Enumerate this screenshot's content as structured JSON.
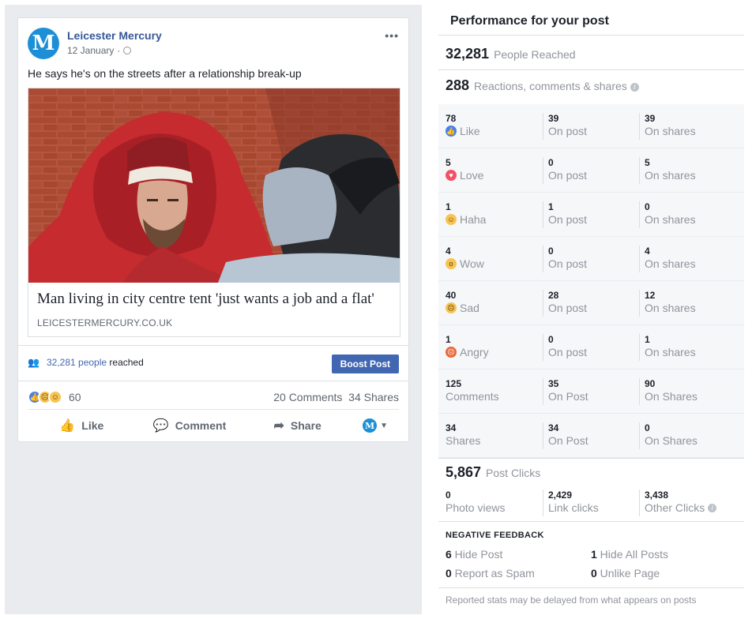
{
  "post": {
    "page_name": "Leicester Mercury",
    "avatar_letter": "M",
    "date": "12 January",
    "meta_sep": "·",
    "more": "•••",
    "text": "He says he's on the streets after a relationship break-up",
    "link_title": "Man living in city centre tent 'just wants a job and a flat'",
    "link_domain": "LEICESTERMERCURY.CO.UK",
    "reach_number": "32,281 people",
    "reach_suffix": " reached",
    "boost_label": "Boost Post",
    "reaction_count": "60",
    "comments": "20 Comments",
    "shares": "34 Shares",
    "actions": {
      "like": "Like",
      "comment": "Comment",
      "share": "Share"
    }
  },
  "performance": {
    "title": "Performance for your post",
    "reached_num": "32,281",
    "reached_label": "People Reached",
    "engagement_num": "288",
    "engagement_label": "Reactions, comments & shares",
    "rows": [
      {
        "icon": "like-icon",
        "c1": "78",
        "l1": "Like",
        "c2": "39",
        "l2": "On post",
        "c3": "39",
        "l3": "On shares"
      },
      {
        "icon": "love-icon",
        "c1": "5",
        "l1": "Love",
        "c2": "0",
        "l2": "On post",
        "c3": "5",
        "l3": "On shares"
      },
      {
        "icon": "haha-icon",
        "c1": "1",
        "l1": "Haha",
        "c2": "1",
        "l2": "On post",
        "c3": "0",
        "l3": "On shares"
      },
      {
        "icon": "wow-icon",
        "c1": "4",
        "l1": "Wow",
        "c2": "0",
        "l2": "On post",
        "c3": "4",
        "l3": "On shares"
      },
      {
        "icon": "sad-icon",
        "c1": "40",
        "l1": "Sad",
        "c2": "28",
        "l2": "On post",
        "c3": "12",
        "l3": "On shares"
      },
      {
        "icon": "angry-icon",
        "c1": "1",
        "l1": "Angry",
        "c2": "0",
        "l2": "On post",
        "c3": "1",
        "l3": "On shares"
      },
      {
        "icon": "",
        "c1": "125",
        "l1": "Comments",
        "c2": "35",
        "l2": "On Post",
        "c3": "90",
        "l3": "On Shares"
      },
      {
        "icon": "",
        "c1": "34",
        "l1": "Shares",
        "c2": "34",
        "l2": "On Post",
        "c3": "0",
        "l3": "On Shares"
      }
    ],
    "clicks_num": "5,867",
    "clicks_label": "Post Clicks",
    "clicks": [
      {
        "num": "0",
        "label": "Photo views"
      },
      {
        "num": "2,429",
        "label": "Link clicks"
      },
      {
        "num": "3,438",
        "label": "Other Clicks"
      }
    ],
    "negative_title": "NEGATIVE FEEDBACK",
    "negative": [
      {
        "num": "6",
        "label": " Hide Post"
      },
      {
        "num": "1",
        "label": " Hide All Posts"
      },
      {
        "num": "0",
        "label": " Report as Spam"
      },
      {
        "num": "0",
        "label": " Unlike Page"
      }
    ],
    "footnote": "Reported stats may be delayed from what appears on posts"
  }
}
